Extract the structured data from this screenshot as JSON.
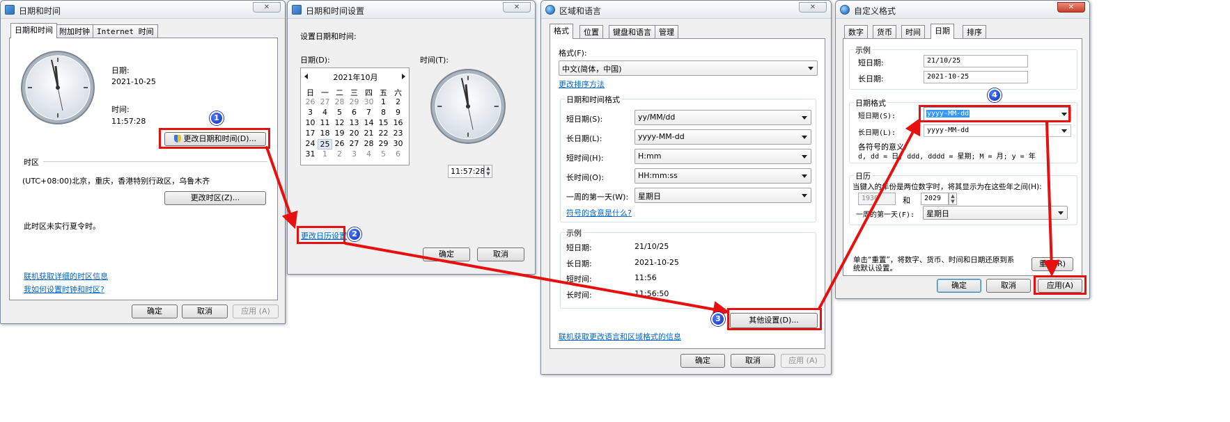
{
  "win1": {
    "title": "日期和时间",
    "tabs": [
      "日期和时间",
      "附加时钟",
      "Internet 时间"
    ],
    "date_label": "日期:",
    "date_value": "2021-10-25",
    "time_label": "时间:",
    "time_value": "11:57:28",
    "change_datetime_button": "更改日期和时间(D)...",
    "timezone_heading": "时区",
    "timezone_value": "(UTC+08:00)北京，重庆，香港特别行政区，乌鲁木齐",
    "change_timezone_button": "更改时区(Z)...",
    "dst_note": "此时区未实行夏令时。",
    "link_online": "联机获取详细的时区信息",
    "link_howto": "我如何设置时钟和时区?",
    "ok": "确定",
    "cancel": "取消",
    "apply": "应用 (A)"
  },
  "win2": {
    "title": "日期和时间设置",
    "heading": "设置日期和时间:",
    "date_label": "日期(D):",
    "time_label": "时间(T):",
    "calendar_month": "2021年10月",
    "weekday_headers": [
      "日",
      "一",
      "二",
      "三",
      "四",
      "五",
      "六"
    ],
    "calendar_days": [
      "26",
      "27",
      "28",
      "29",
      "30",
      "1",
      "2",
      "3",
      "4",
      "5",
      "6",
      "7",
      "8",
      "9",
      "10",
      "11",
      "12",
      "13",
      "14",
      "15",
      "16",
      "17",
      "18",
      "19",
      "20",
      "21",
      "22",
      "23",
      "24",
      "25",
      "26",
      "27",
      "28",
      "29",
      "30",
      "31",
      "1",
      "2",
      "3",
      "4",
      "5",
      "6"
    ],
    "time_value": "11:57:28",
    "change_calendar_link": "更改日历设置",
    "ok": "确定",
    "cancel": "取消"
  },
  "win3": {
    "title": "区域和语言",
    "tabs": [
      "格式",
      "位置",
      "键盘和语言",
      "管理"
    ],
    "format_label": "格式(F):",
    "format_value": "中文(简体，中国)",
    "sort_link": "更改排序方法",
    "datetime_group": "日期和时间格式",
    "short_date_label": "短日期(S):",
    "short_date_value": "yy/MM/dd",
    "long_date_label": "长日期(L):",
    "long_date_value": "yyyy-MM-dd",
    "short_time_label": "短时间(H):",
    "short_time_value": "H:mm",
    "long_time_label": "长时间(O):",
    "long_time_value": "HH:mm:ss",
    "first_day_label": "一周的第一天(W):",
    "first_day_value": "星期日",
    "symbol_link": "符号的含意是什么?",
    "example_group": "示例",
    "ex_short_date_label": "短日期:",
    "ex_short_date_value": "21/10/25",
    "ex_long_date_label": "长日期:",
    "ex_long_date_value": "2021-10-25",
    "ex_short_time_label": "短时间:",
    "ex_short_time_value": "11:56",
    "ex_long_time_label": "长时间:",
    "ex_long_time_value": "11:56:50",
    "other_settings_button": "其他设置(D)...",
    "online_link": "联机获取更改语言和区域格式的信息",
    "ok": "确定",
    "cancel": "取消",
    "apply": "应用 (A)"
  },
  "win4": {
    "title": "自定义格式",
    "tabs": [
      "数字",
      "货币",
      "时间",
      "日期",
      "排序"
    ],
    "example_group": "示例",
    "short_date_label": "短日期:",
    "short_date_value": "21/10/25",
    "long_date_label": "长日期:",
    "long_date_value": "2021-10-25",
    "date_format_group": "日期格式",
    "fmt_short_label": "短日期(S):",
    "fmt_short_value": "yyyy-MM-dd",
    "fmt_long_label": "长日期(L):",
    "fmt_long_value": "yyyy-MM-dd",
    "symbol_meaning_label": "各符号的意义:",
    "symbol_meaning_text": "d, dd = 日; ddd, dddd = 星期; M = 月; y = 年",
    "calendar_group": "日历",
    "two_digit_text": "当键入的年份是两位数字时，将其显示为在这些年之间(H):",
    "year_from": "1930",
    "year_and": "和",
    "year_to": "2029",
    "first_day_label": "一周的第一天(F):",
    "first_day_value": "星期日",
    "reset_text": "单击“重置”，将数字、货币、时间和日期还原到系统默认设置。",
    "reset_button": "重置(R)",
    "ok": "确定",
    "cancel": "取消",
    "apply": "应用(A)"
  },
  "annotations": {
    "step1": "1",
    "step2": "2",
    "step3": "3",
    "step4": "4"
  },
  "colors": {
    "annotation_red": "#e8100f",
    "badge_blue": "#1a3fd6",
    "link_blue": "#0066cc",
    "selection_blue": "#3399ff"
  }
}
